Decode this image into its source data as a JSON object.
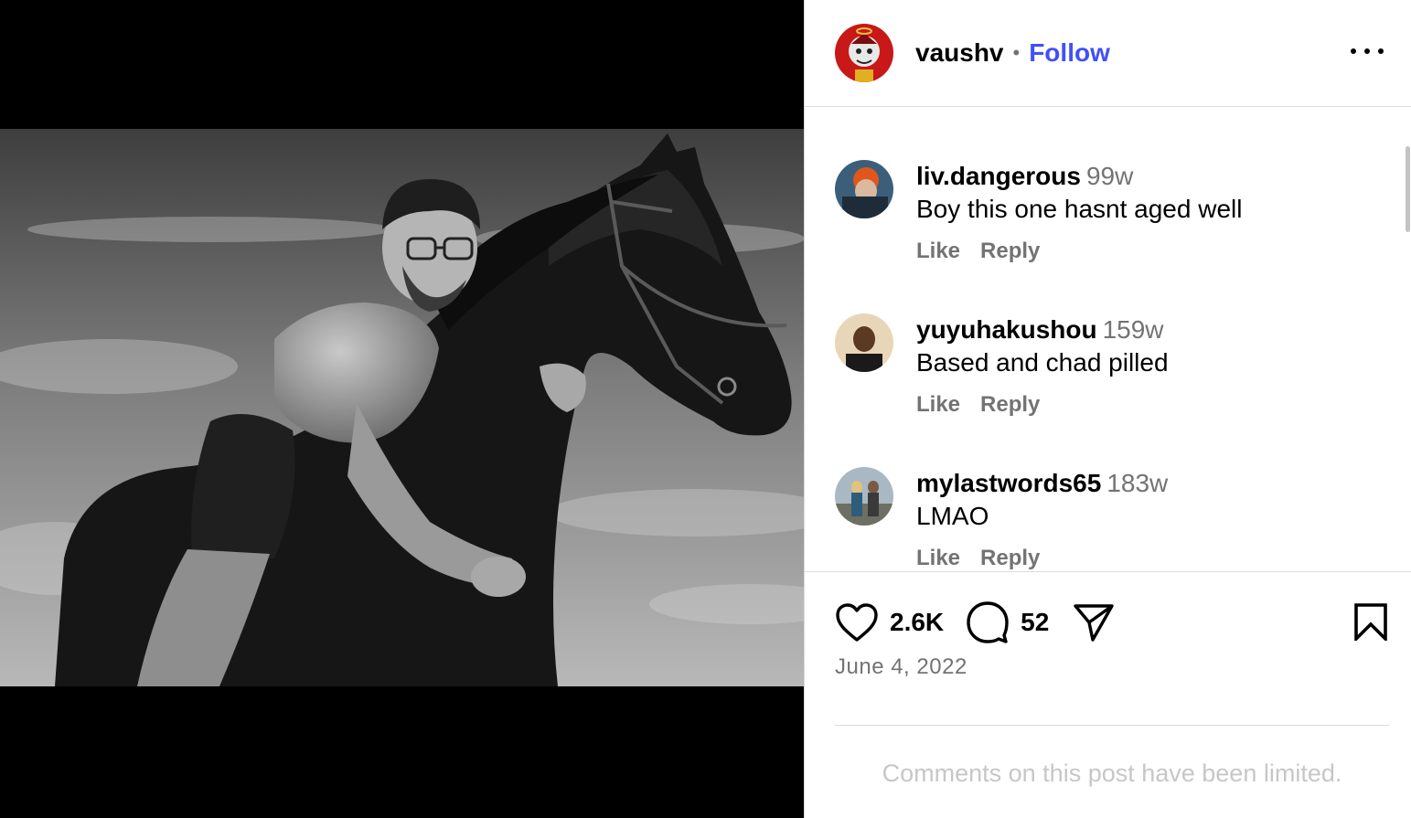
{
  "post": {
    "author": "vaushv",
    "separator": "•",
    "follow_label": "Follow",
    "more_icon": "more-horizontal-icon"
  },
  "media": {
    "description_icon": "photo"
  },
  "comments": [
    {
      "username": "liv.dangerous",
      "time": "99w",
      "text": "Boy this one hasnt aged well",
      "like_label": "Like",
      "reply_label": "Reply"
    },
    {
      "username": "yuyuhakushou",
      "time": "159w",
      "text": "Based and chad pilled",
      "like_label": "Like",
      "reply_label": "Reply"
    },
    {
      "username": "mylastwords65",
      "time": "183w",
      "text": "LMAO",
      "like_label": "Like",
      "reply_label": "Reply"
    }
  ],
  "footer": {
    "likes": "2.6K",
    "comments_count": "52",
    "date": "June 4, 2022",
    "limited_notice": "Comments on this post have been limited.",
    "icons": [
      "heart-icon",
      "comment-icon",
      "share-icon",
      "bookmark-icon"
    ]
  },
  "colors": {
    "follow": "#4150f7",
    "muted": "#737373",
    "divider": "#dbdbdb",
    "limited": "#c7c7c7"
  }
}
